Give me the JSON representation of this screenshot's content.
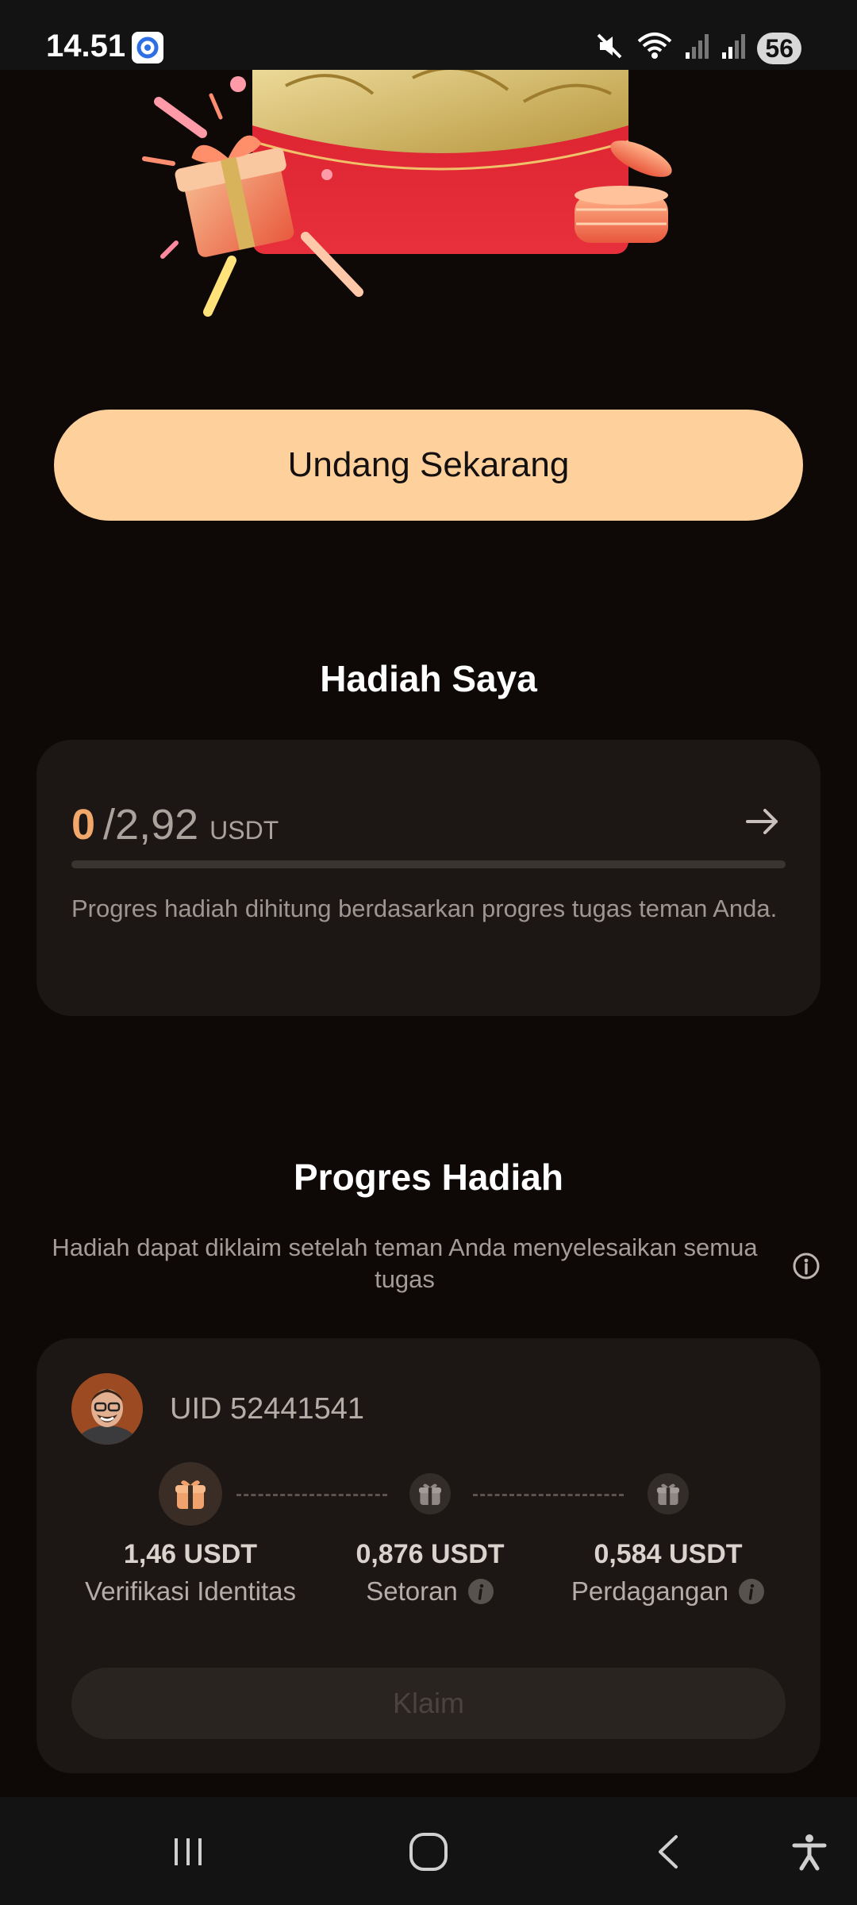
{
  "status_bar": {
    "time": "14.51",
    "battery": "56"
  },
  "invite": {
    "button_label": "Undang Sekarang"
  },
  "my_rewards": {
    "title": "Hadiah Saya",
    "current": "0",
    "total": "/2,92",
    "unit": "USDT",
    "progress": 0,
    "note": "Progres hadiah dihitung berdasarkan progres tugas teman Anda."
  },
  "reward_progress": {
    "title": "Progres Hadiah",
    "hint": "Hadiah dapat diklaim setelah teman Anda menyelesaikan semua tugas",
    "friend": {
      "uid": "UID 52441541",
      "steps": [
        {
          "amount": "1,46 USDT",
          "label": "Verifikasi Identitas",
          "active": true
        },
        {
          "amount": "0,876 USDT",
          "label": "Setoran",
          "active": false
        },
        {
          "amount": "0,584 USDT",
          "label": "Perdagangan",
          "active": false
        }
      ],
      "claim_label": "Klaim"
    }
  },
  "colors": {
    "accent": "#fdd09c",
    "accent_text": "#f2a76b",
    "background": "#0e0907",
    "card": "#1c1715"
  }
}
